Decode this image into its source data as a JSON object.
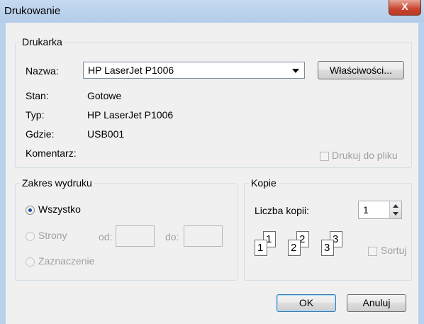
{
  "window": {
    "title": "Drukowanie",
    "close_label": "X"
  },
  "printer": {
    "group_label": "Drukarka",
    "name_label": "Nazwa:",
    "name_value": "HP LaserJet P1006",
    "properties_button": "Właściwości...",
    "status_label": "Stan:",
    "status_value": "Gotowe",
    "type_label": "Typ:",
    "type_value": "HP LaserJet P1006",
    "where_label": "Gdzie:",
    "where_value": "USB001",
    "comment_label": "Komentarz:",
    "print_to_file_label": "Drukuj do pliku",
    "print_to_file_checked": false
  },
  "range": {
    "group_label": "Zakres wydruku",
    "all_label": "Wszystko",
    "pages_label": "Strony",
    "from_label": "od:",
    "to_label": "do:",
    "from_value": "",
    "to_value": "",
    "selection_label": "Zaznaczenie",
    "selected": "all"
  },
  "copies": {
    "group_label": "Kopie",
    "count_label": "Liczba kopii:",
    "count_value": "1",
    "collate_label": "Sortuj",
    "collate_checked": false,
    "page_numbers": [
      "1",
      "1",
      "2",
      "2",
      "3",
      "3"
    ]
  },
  "buttons": {
    "ok": "OK",
    "cancel": "Anuluj"
  }
}
